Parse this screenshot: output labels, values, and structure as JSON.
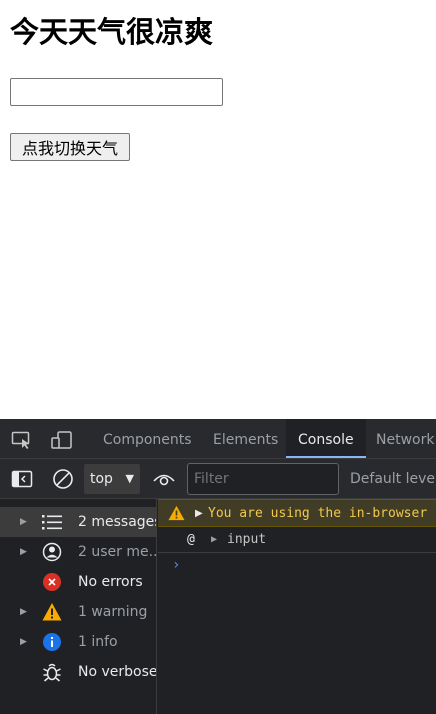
{
  "page": {
    "heading": "今天天气很凉爽",
    "input_value": "",
    "button_label": "点我切换天气"
  },
  "devtools": {
    "tabs": [
      {
        "label": "Components",
        "active": false
      },
      {
        "label": "Elements",
        "active": false
      },
      {
        "label": "Console",
        "active": true
      },
      {
        "label": "Network",
        "active": false
      }
    ],
    "toolbar": {
      "context": "top",
      "filter_placeholder": "Filter",
      "levels_label": "Default levels"
    },
    "sidebar": {
      "items": [
        {
          "label": "2 messages",
          "icon": "list-icon"
        },
        {
          "label": "2 user me...",
          "icon": "user-icon"
        },
        {
          "label": "No errors",
          "icon": "error-icon"
        },
        {
          "label": "1 warning",
          "icon": "warning-icon"
        },
        {
          "label": "1 info",
          "icon": "info-icon"
        },
        {
          "label": "No verbose",
          "icon": "bug-icon"
        }
      ]
    },
    "console": {
      "warning_text": "You are using the in-browser",
      "stack_at": "@",
      "stack_label": "input",
      "prompt": "›"
    },
    "colors": {
      "panel_bg": "#202124",
      "toolbar_bg": "#292a2d",
      "accent": "#8ab4f8",
      "warning_text": "#f2c94c",
      "warning_bg": "#413c26",
      "error_red": "#d93025",
      "info_blue": "#1a73e8"
    }
  }
}
